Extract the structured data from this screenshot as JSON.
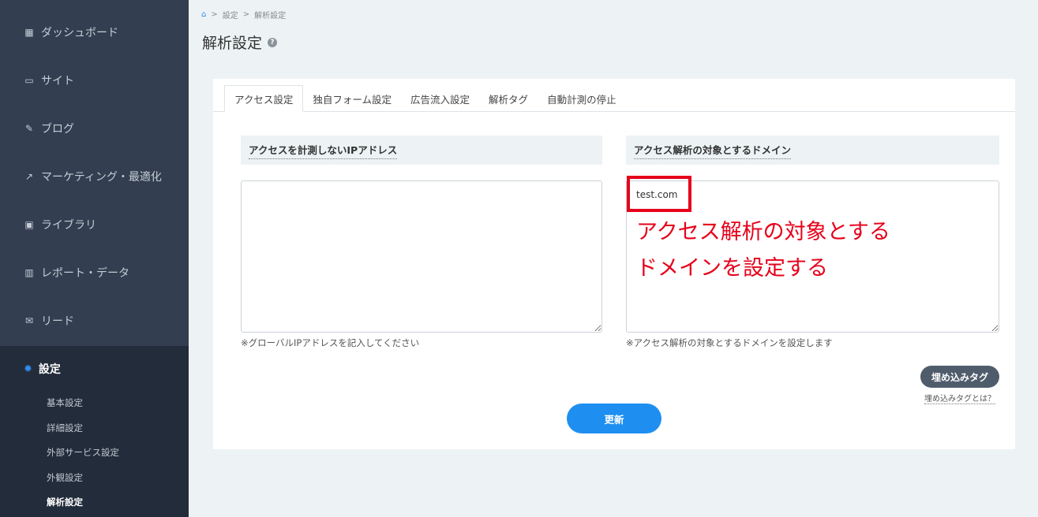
{
  "sidebar": {
    "items": [
      {
        "label": "ダッシュボード",
        "icon": "dashboard-icon"
      },
      {
        "label": "サイト",
        "icon": "site-icon"
      },
      {
        "label": "ブログ",
        "icon": "pencil-icon"
      },
      {
        "label": "マーケティング・最適化",
        "icon": "trend-icon"
      },
      {
        "label": "ライブラリ",
        "icon": "image-icon"
      },
      {
        "label": "レポート・データ",
        "icon": "bar-chart-icon"
      },
      {
        "label": "リード",
        "icon": "mail-icon"
      }
    ],
    "settings": {
      "label": "設定",
      "icon": "gear-icon",
      "subitems": [
        "基本設定",
        "詳細設定",
        "外部サービス設定",
        "外観設定",
        "解析設定"
      ],
      "active": "解析設定"
    }
  },
  "breadcrumb": {
    "items": [
      "設定",
      "解析設定"
    ],
    "separator": ">"
  },
  "page": {
    "title": "解析設定"
  },
  "tabs": [
    "アクセス設定",
    "独自フォーム設定",
    "広告流入設定",
    "解析タグ",
    "自動計測の停止"
  ],
  "active_tab": "アクセス設定",
  "left": {
    "heading": "アクセスを計測しないIPアドレス",
    "value": "",
    "note": "※グローバルIPアドレスを記入してください"
  },
  "right": {
    "heading": "アクセス解析の対象とするドメイン",
    "value": "test.com",
    "note": "※アクセス解析の対象とするドメインを設定します"
  },
  "annotation": {
    "line1": "アクセス解析の対象とする",
    "line2": "ドメインを設定する"
  },
  "buttons": {
    "embed": "埋め込みタグ",
    "embed_help": "埋め込みタグとは？",
    "update": "更新"
  },
  "colors": {
    "sidebar": "#333f50",
    "sidebar_active": "#232c3a",
    "accent": "#1e8ff0",
    "annotation": "#e6001a"
  }
}
